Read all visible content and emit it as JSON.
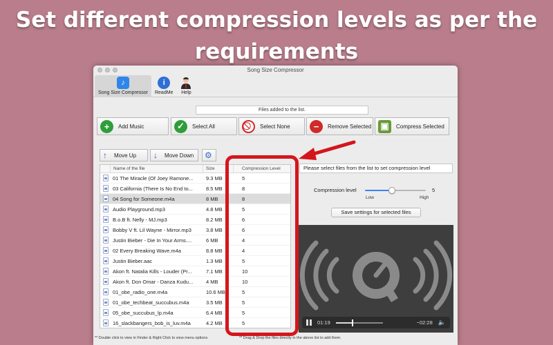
{
  "headline": {
    "line1": "Set different compression levels as per the",
    "line2": "requirements"
  },
  "window": {
    "title": "Song Size Compressor"
  },
  "toolbar": {
    "items": [
      {
        "label": "Song Size Compressor",
        "icon": "music-note-icon",
        "color": "#2f86e8"
      },
      {
        "label": "ReadMe",
        "icon": "info-icon",
        "color": "#2f6fd6"
      },
      {
        "label": "Help",
        "icon": "person-icon",
        "color": "#5a4638"
      }
    ]
  },
  "files_added_label": "Files added to the list.",
  "actions": {
    "add_music": "Add Music",
    "select_all": "Select All",
    "select_none": "Select None",
    "remove_selected": "Remove Selected",
    "compress_selected": "Compress Selected"
  },
  "reorder": {
    "move_up": "Move Up",
    "move_down": "Move Down",
    "settings_icon": "gear-icon"
  },
  "table": {
    "headers": {
      "name": "Name of the file",
      "size": "Size",
      "level": "Compression Level"
    },
    "rows": [
      {
        "name": "01 The Miracle (Of Joey Ramone...",
        "size": "9.3 MB",
        "level": "5"
      },
      {
        "name": "03 California (There Is No End to...",
        "size": "8.5 MB",
        "level": "8"
      },
      {
        "name": "04 Song for Someone.m4a",
        "size": "8 MB",
        "level": "8"
      },
      {
        "name": "Audio Playground.mp3",
        "size": "4.8 MB",
        "level": "5"
      },
      {
        "name": "B.o.B ft. Nelly - MJ.mp3",
        "size": "8.2 MB",
        "level": "6"
      },
      {
        "name": "Bobby V ft. Lil Wayne - Mirror.mp3",
        "size": "3.8 MB",
        "level": "6"
      },
      {
        "name": "Justin Bieber - Die In Your Arms....",
        "size": "6 MB",
        "level": "4"
      },
      {
        "name": "02 Every Breaking Wave.m4a",
        "size": "8.8 MB",
        "level": "4"
      },
      {
        "name": "Justin Bieber.aac",
        "size": "1.3 MB",
        "level": "5"
      },
      {
        "name": "Akon ft. Natalia Kills - Louder (Pr...",
        "size": "7.1 MB",
        "level": "10"
      },
      {
        "name": "Akon ft. Don Omar - Danza Kudu...",
        "size": "4 MB",
        "level": "10"
      },
      {
        "name": "01_obe_radio_one.m4a",
        "size": "10.6 MB",
        "level": "5"
      },
      {
        "name": "01_obe_techbeat_succubus.m4a",
        "size": "3.5 MB",
        "level": "5"
      },
      {
        "name": "05_obe_succubus_lp.m4a",
        "size": "6.4 MB",
        "level": "5"
      },
      {
        "name": "16_slackbangers_bob_is_luv.m4a",
        "size": "4.2 MB",
        "level": "5"
      }
    ],
    "selected_index": 2
  },
  "settings_panel": {
    "hint": "Please select files from the list to set compression level",
    "compression_label": "Compression level",
    "compression_value": "5",
    "compression_fraction": 0.44,
    "low_label": "Low",
    "high_label": "High",
    "save_button": "Save settings for selected files"
  },
  "player": {
    "elapsed": "01:19",
    "remaining": "−02:28",
    "progress_fraction": 0.35,
    "logo_icon": "quicktime-logo-icon",
    "volume_icon": "speaker-icon"
  },
  "footer": {
    "left": "** Double click to view in Finder & Right Click  to view menu options",
    "right": "** Drag & Drop the files directly in the above list to add them."
  },
  "colors": {
    "background": "#b97d8b",
    "highlight": "#d4161c"
  }
}
